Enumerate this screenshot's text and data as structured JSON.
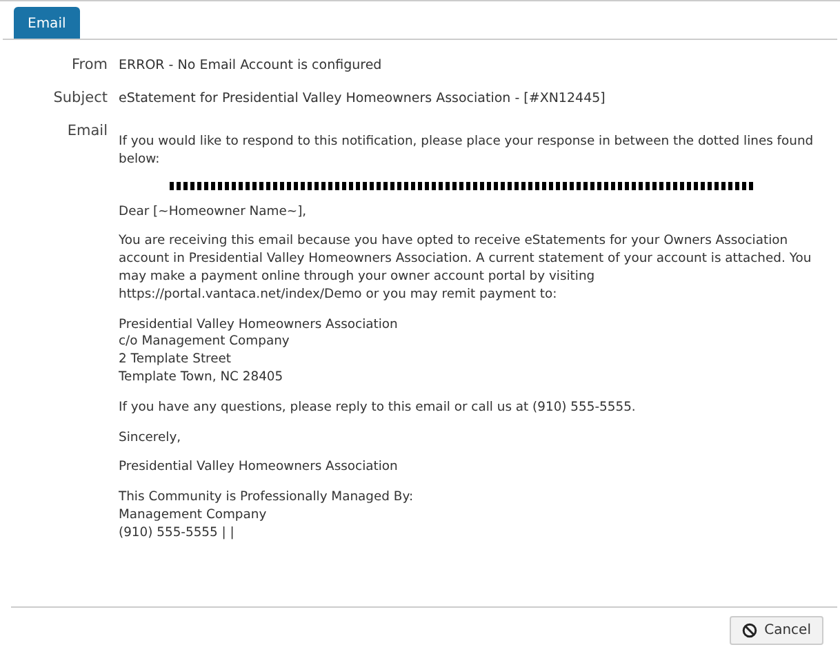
{
  "tabs": [
    {
      "label": "Email",
      "selected": true
    }
  ],
  "fields": [
    {
      "label": "From",
      "value": "ERROR - No Email Account is configured"
    },
    {
      "label": "Subject",
      "value": "eStatement for Presidential Valley Homeowners Association - [#XN12445]"
    }
  ],
  "email": {
    "label": "Email",
    "blocks": [
      {
        "kind": "text",
        "text": "If you would like to respond to this notification, please place your response in between the dotted lines found below:"
      },
      {
        "kind": "dots"
      },
      {
        "kind": "text",
        "text": "Dear [~Homeowner Name~],"
      },
      {
        "kind": "text",
        "text": "You are receiving this email because you have opted to receive eStatements for your Owners Association account in Presidential Valley Homeowners Association. A current statement of your account is attached. You may make a payment online through your owner account portal by visiting https://portal.vantaca.net/index/Demo or you may remit payment to:"
      },
      {
        "kind": "lines",
        "lines": [
          "Presidential Valley Homeowners Association",
          "c/o Management Company",
          "2 Template Street",
          "Template Town, NC  28405"
        ]
      },
      {
        "kind": "text",
        "text": "If you have any questions, please reply to this email or call us at (910) 555-5555."
      },
      {
        "kind": "text",
        "text": "Sincerely,"
      },
      {
        "kind": "text",
        "text": "Presidential Valley Homeowners Association"
      },
      {
        "kind": "lines",
        "lines": [
          "This Community is Professionally Managed By:",
          "Management Company",
          "(910) 555-5555 | |"
        ]
      }
    ]
  },
  "buttons": [
    {
      "label": "Cancel"
    }
  ]
}
